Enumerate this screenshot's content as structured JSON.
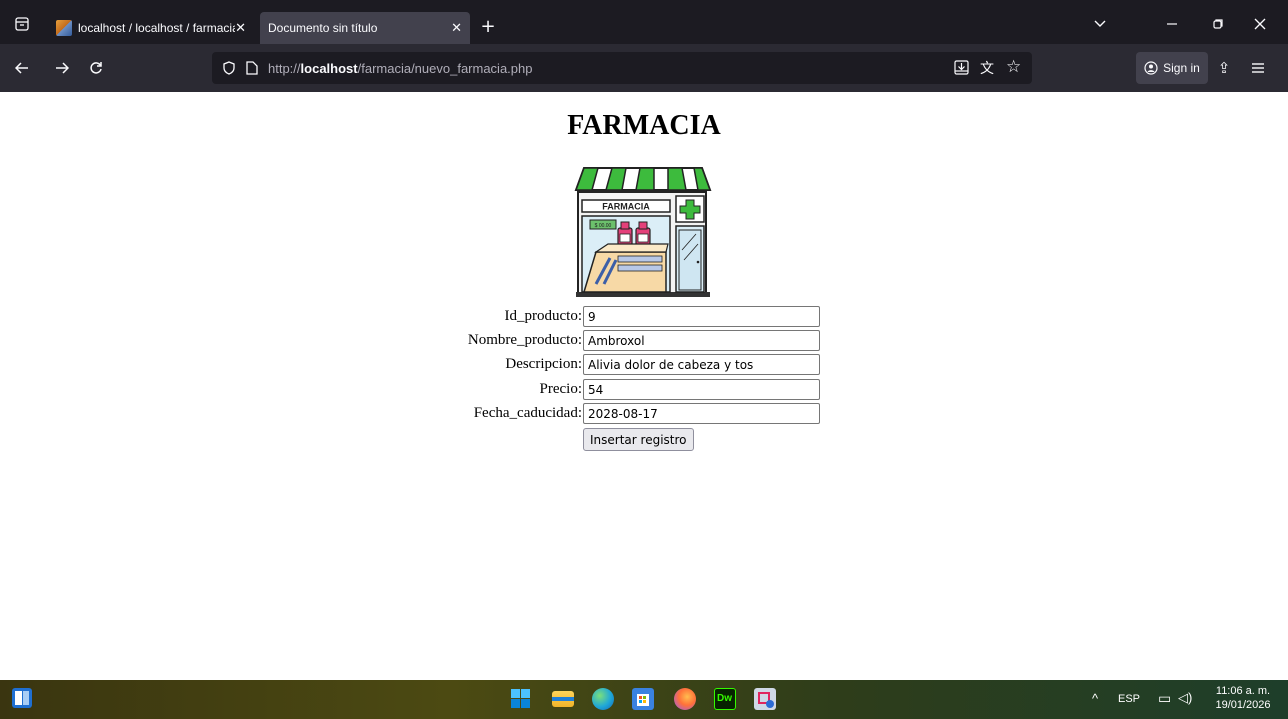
{
  "browser": {
    "tabs": [
      {
        "title": "localhost / localhost / farmacia |",
        "active": false
      },
      {
        "title": "Documento sin título",
        "active": true
      }
    ],
    "url": {
      "prefix": "http://",
      "host": "localhost",
      "path": "/farmacia/nuevo_farmacia.php"
    },
    "signin_label": "Sign in",
    "icons": [
      "tab-list-icon",
      "close-icon",
      "new-tab-icon",
      "chevron-down-icon",
      "minimize-icon",
      "restore-icon",
      "back-icon",
      "forward-icon",
      "reload-icon",
      "shield-icon",
      "page-icon",
      "save-page-icon",
      "translate-icon",
      "bookmark-star-icon",
      "account-icon",
      "extensions-icon",
      "menu-icon"
    ]
  },
  "page": {
    "title": "FARMACIA",
    "image": {
      "sign_text": "FARMACIA",
      "price_tag": "$ 00.00"
    },
    "form": {
      "fields": [
        {
          "label": "Id_producto:",
          "value": "9"
        },
        {
          "label": "Nombre_producto:",
          "value": "Ambroxol"
        },
        {
          "label": "Descripcion:",
          "value": "Alivia dolor de cabeza y tos"
        },
        {
          "label": "Precio:",
          "value": "54"
        },
        {
          "label": "Fecha_caducidad:",
          "value": "2028-08-17"
        }
      ],
      "submit_label": "Insertar registro"
    }
  },
  "taskbar": {
    "language": "ESP",
    "time": "11:06 a. m.",
    "date": "19/01/2026",
    "apps": [
      "windows-start-icon",
      "file-explorer-icon",
      "edge-icon",
      "store-icon",
      "firefox-icon",
      "dreamweaver-icon",
      "snipping-tool-icon"
    ],
    "colors": {
      "accent": "#0078d4"
    }
  }
}
